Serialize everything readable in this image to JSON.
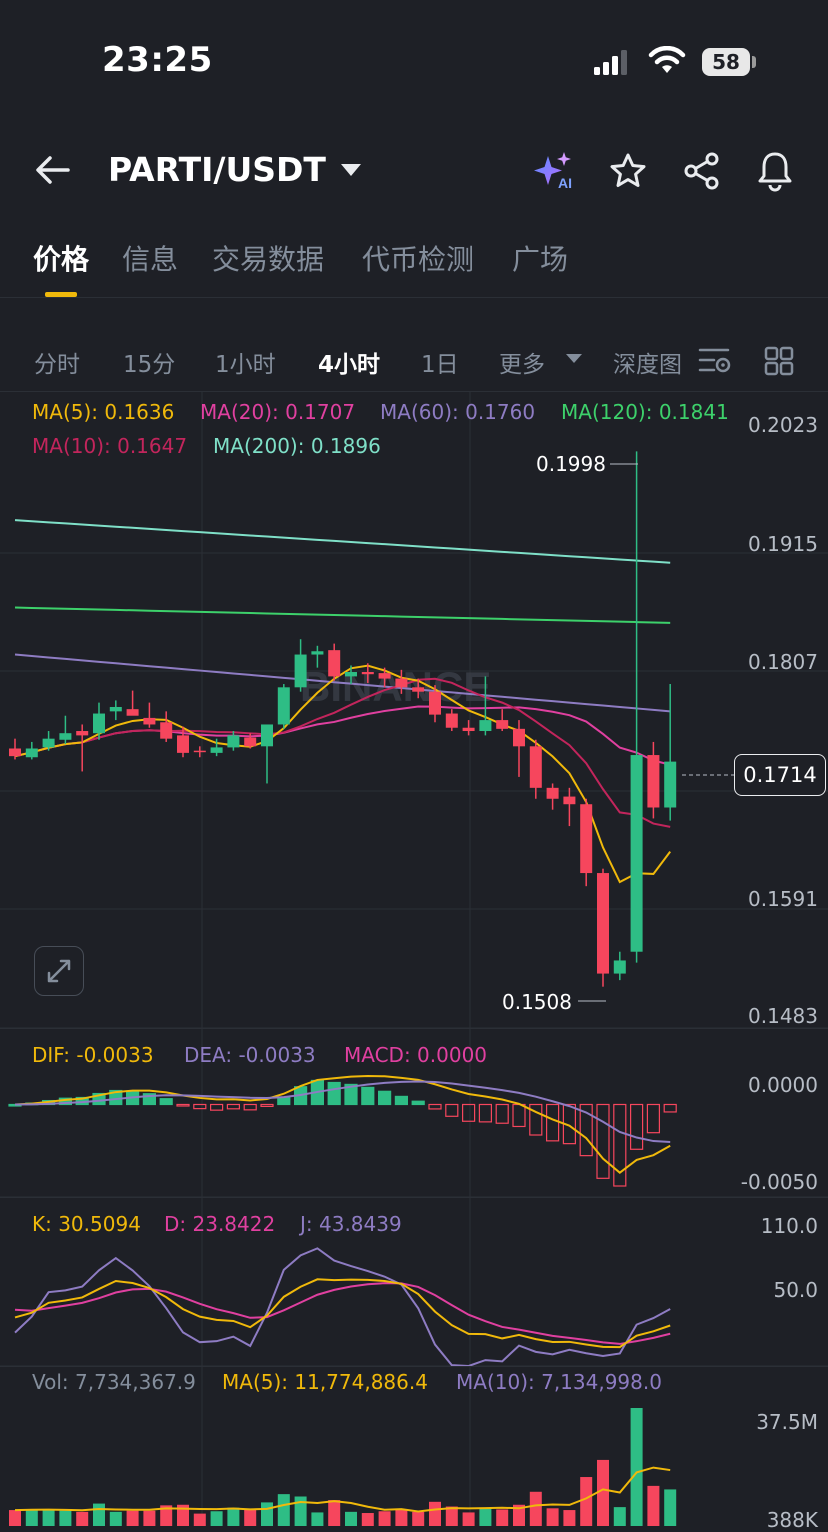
{
  "status_bar": {
    "time": "23:25",
    "battery": "58"
  },
  "header": {
    "pair": "PARTI/USDT"
  },
  "tabs": [
    {
      "label": "价格",
      "active": true
    },
    {
      "label": "信息"
    },
    {
      "label": "交易数据"
    },
    {
      "label": "代币检测"
    },
    {
      "label": "广场"
    }
  ],
  "timeframes": [
    {
      "label": "分时"
    },
    {
      "label": "15分"
    },
    {
      "label": "1小时"
    },
    {
      "label": "4小时",
      "active": true
    },
    {
      "label": "1日"
    },
    {
      "label": "更多"
    },
    {
      "label": "深度图"
    }
  ],
  "main_chart": {
    "ma_labels": {
      "ma5": "MA(5): 0.1636",
      "ma20": "MA(20): 0.1707",
      "ma60": "MA(60): 0.1760",
      "ma120": "MA(120): 0.1841",
      "ma10": "MA(10): 0.1647",
      "ma200": "MA(200): 0.1896"
    },
    "y_ticks": [
      "0.2023",
      "0.1915",
      "0.1807",
      "0.1591",
      "0.1483"
    ],
    "high_label": "0.1998",
    "low_label": "0.1508",
    "current_price": "0.1714",
    "watermark": "BINANCE"
  },
  "macd_panel": {
    "dif": "DIF: -0.0033",
    "dea": "DEA: -0.0033",
    "macd": "MACD: 0.0000",
    "y_ticks": [
      "0.0000",
      "-0.0050"
    ]
  },
  "kdj_panel": {
    "k": "K: 30.5094",
    "d": "D: 23.8422",
    "j": "J: 43.8439",
    "y_ticks": [
      "110.0",
      "50.0"
    ]
  },
  "vol_panel": {
    "vol": "Vol: 7,734,367.9",
    "ma5": "MA(5): 11,774,886.4",
    "ma10": "MA(10): 7,134,998.0",
    "y_ticks": [
      "37.5M",
      "388K"
    ]
  },
  "colors": {
    "up": "#2ebd85",
    "down": "#f6465d",
    "accent": "#f0b90b",
    "ma5": "#f0b90b",
    "ma10": "#c2255c",
    "ma20": "#e040a0",
    "ma60": "#8e7cc3",
    "ma120": "#3dd16b",
    "ma200": "#7fe0c8"
  },
  "chart_data": {
    "type": "candlestick",
    "ylim": [
      0.1483,
      0.2023
    ],
    "candles": [
      {
        "o": 0.1726,
        "h": 0.1735,
        "l": 0.1716,
        "c": 0.1719
      },
      {
        "o": 0.1718,
        "h": 0.1732,
        "l": 0.1716,
        "c": 0.1726
      },
      {
        "o": 0.1727,
        "h": 0.1742,
        "l": 0.1724,
        "c": 0.1735
      },
      {
        "o": 0.1734,
        "h": 0.1756,
        "l": 0.173,
        "c": 0.174
      },
      {
        "o": 0.1742,
        "h": 0.1748,
        "l": 0.1705,
        "c": 0.1738
      },
      {
        "o": 0.174,
        "h": 0.1768,
        "l": 0.1734,
        "c": 0.1758
      },
      {
        "o": 0.176,
        "h": 0.177,
        "l": 0.1752,
        "c": 0.1764
      },
      {
        "o": 0.1762,
        "h": 0.1779,
        "l": 0.1758,
        "c": 0.1756
      },
      {
        "o": 0.1754,
        "h": 0.1768,
        "l": 0.1745,
        "c": 0.1748
      },
      {
        "o": 0.175,
        "h": 0.176,
        "l": 0.1732,
        "c": 0.1735
      },
      {
        "o": 0.1738,
        "h": 0.1746,
        "l": 0.1718,
        "c": 0.1722
      },
      {
        "o": 0.1724,
        "h": 0.1728,
        "l": 0.1718,
        "c": 0.1723
      },
      {
        "o": 0.1722,
        "h": 0.1735,
        "l": 0.1719,
        "c": 0.1727
      },
      {
        "o": 0.1727,
        "h": 0.1742,
        "l": 0.1724,
        "c": 0.1738
      },
      {
        "o": 0.1736,
        "h": 0.174,
        "l": 0.1726,
        "c": 0.1728
      },
      {
        "o": 0.1728,
        "h": 0.1745,
        "l": 0.1694,
        "c": 0.1748
      },
      {
        "o": 0.1748,
        "h": 0.1785,
        "l": 0.1744,
        "c": 0.1782
      },
      {
        "o": 0.1782,
        "h": 0.1826,
        "l": 0.1778,
        "c": 0.1812
      },
      {
        "o": 0.1812,
        "h": 0.182,
        "l": 0.18,
        "c": 0.1815
      },
      {
        "o": 0.1816,
        "h": 0.1822,
        "l": 0.1788,
        "c": 0.1792
      },
      {
        "o": 0.1792,
        "h": 0.1802,
        "l": 0.1785,
        "c": 0.1796
      },
      {
        "o": 0.1796,
        "h": 0.1804,
        "l": 0.1786,
        "c": 0.1794
      },
      {
        "o": 0.1795,
        "h": 0.18,
        "l": 0.1782,
        "c": 0.179
      },
      {
        "o": 0.179,
        "h": 0.1798,
        "l": 0.1776,
        "c": 0.1782
      },
      {
        "o": 0.1782,
        "h": 0.179,
        "l": 0.1772,
        "c": 0.1778
      },
      {
        "o": 0.1778,
        "h": 0.1784,
        "l": 0.175,
        "c": 0.1757
      },
      {
        "o": 0.1758,
        "h": 0.1762,
        "l": 0.1742,
        "c": 0.1745
      },
      {
        "o": 0.1745,
        "h": 0.1752,
        "l": 0.1738,
        "c": 0.1742
      },
      {
        "o": 0.1742,
        "h": 0.1792,
        "l": 0.1738,
        "c": 0.1752
      },
      {
        "o": 0.1752,
        "h": 0.1762,
        "l": 0.1742,
        "c": 0.1744
      },
      {
        "o": 0.1744,
        "h": 0.1752,
        "l": 0.17,
        "c": 0.1728
      },
      {
        "o": 0.1728,
        "h": 0.1734,
        "l": 0.168,
        "c": 0.169
      },
      {
        "o": 0.169,
        "h": 0.1694,
        "l": 0.167,
        "c": 0.168
      },
      {
        "o": 0.1682,
        "h": 0.169,
        "l": 0.1655,
        "c": 0.1675
      },
      {
        "o": 0.1675,
        "h": 0.168,
        "l": 0.16,
        "c": 0.1612
      },
      {
        "o": 0.1612,
        "h": 0.1616,
        "l": 0.1508,
        "c": 0.152
      },
      {
        "o": 0.152,
        "h": 0.154,
        "l": 0.1514,
        "c": 0.1532
      },
      {
        "o": 0.154,
        "h": 0.1998,
        "l": 0.153,
        "c": 0.172
      },
      {
        "o": 0.172,
        "h": 0.1732,
        "l": 0.1662,
        "c": 0.1672
      },
      {
        "o": 0.1672,
        "h": 0.1785,
        "l": 0.166,
        "c": 0.1714
      }
    ]
  }
}
